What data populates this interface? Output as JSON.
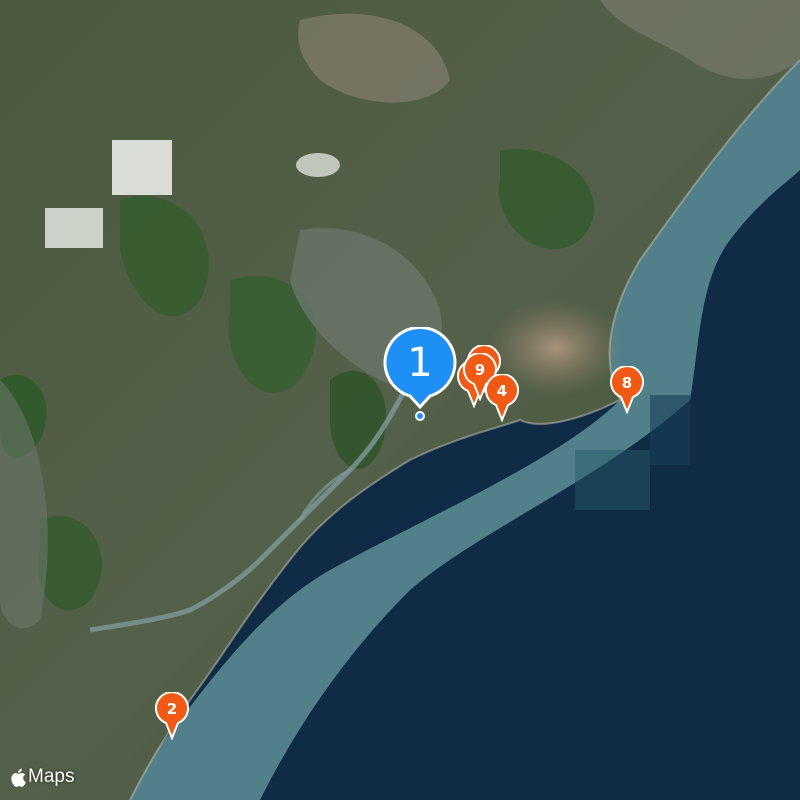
{
  "map": {
    "type": "satellite",
    "colors": {
      "land_dark": "#3e4a36",
      "land_green": "#2f5a2c",
      "urban": "#9a8a78",
      "shallow_water": "#6e9ea3",
      "deep_water": "#0f2b45",
      "pin_orange": "#f05a14",
      "pin_blue": "#1e8ff5"
    }
  },
  "markers": [
    {
      "id": "marker-1",
      "label": "1",
      "style": "primary"
    },
    {
      "id": "marker-9",
      "label": "9",
      "style": "secondary"
    },
    {
      "id": "marker-4",
      "label": "4",
      "style": "secondary"
    },
    {
      "id": "marker-8",
      "label": "8",
      "style": "secondary"
    },
    {
      "id": "marker-2",
      "label": "2",
      "style": "secondary"
    }
  ],
  "attribution": {
    "icon": "apple-logo-icon",
    "text": "Maps"
  }
}
